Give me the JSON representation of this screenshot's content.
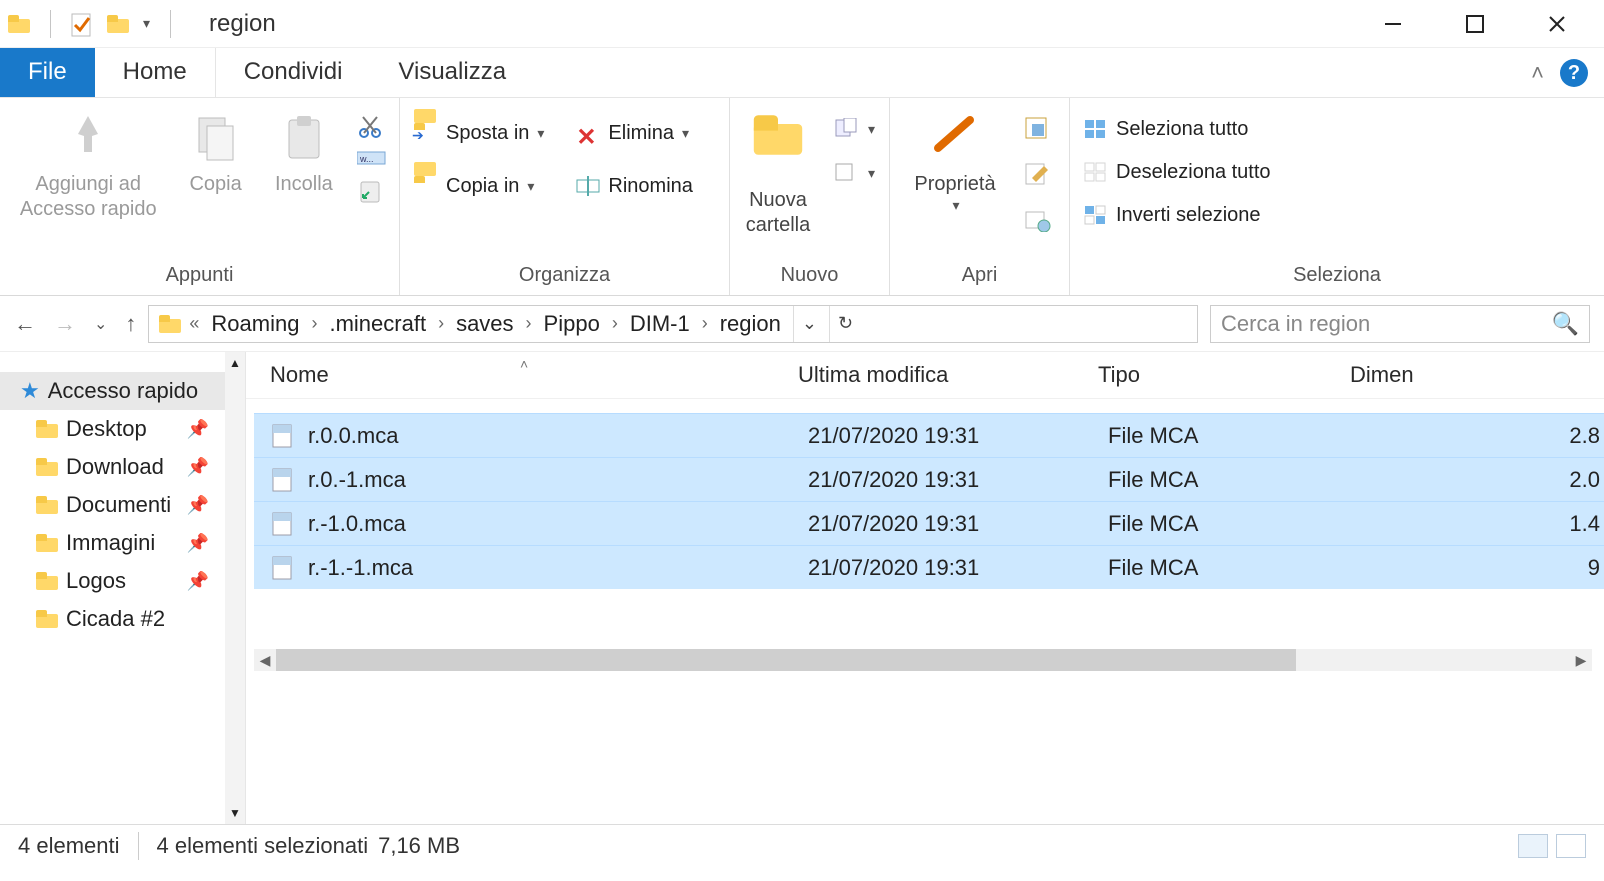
{
  "window": {
    "title": "region"
  },
  "tabs": {
    "file": "File",
    "home": "Home",
    "share": "Condividi",
    "view": "Visualizza"
  },
  "ribbon": {
    "clipboard": {
      "pin": "Aggiungi ad\nAccesso rapido",
      "copy": "Copia",
      "paste": "Incolla",
      "group": "Appunti"
    },
    "organize": {
      "move": "Sposta in",
      "copyto": "Copia in",
      "delete": "Elimina",
      "rename": "Rinomina",
      "group": "Organizza"
    },
    "new": {
      "folder": "Nuova\ncartella",
      "group": "Nuovo"
    },
    "open": {
      "props": "Proprietà",
      "group": "Apri"
    },
    "select": {
      "all": "Seleziona tutto",
      "none": "Deseleziona tutto",
      "invert": "Inverti selezione",
      "group": "Seleziona"
    }
  },
  "breadcrumb": [
    "Roaming",
    ".minecraft",
    "saves",
    "Pippo",
    "DIM-1",
    "region"
  ],
  "search": {
    "placeholder": "Cerca in region"
  },
  "sidebar": {
    "head": "Accesso rapido",
    "items": [
      "Desktop",
      "Download",
      "Documenti",
      "Immagini",
      "Logos",
      "Cicada #2"
    ]
  },
  "columns": {
    "name": "Nome",
    "date": "Ultima modifica",
    "type": "Tipo",
    "size": "Dimen"
  },
  "rows": [
    {
      "name": "r.0.0.mca",
      "date": "21/07/2020 19:31",
      "type": "File MCA",
      "size": "2.8"
    },
    {
      "name": "r.0.-1.mca",
      "date": "21/07/2020 19:31",
      "type": "File MCA",
      "size": "2.0"
    },
    {
      "name": "r.-1.0.mca",
      "date": "21/07/2020 19:31",
      "type": "File MCA",
      "size": "1.4"
    },
    {
      "name": "r.-1.-1.mca",
      "date": "21/07/2020 19:31",
      "type": "File MCA",
      "size": "9"
    }
  ],
  "status": {
    "count": "4 elementi",
    "selected": "4 elementi selezionati",
    "size": "7,16 MB"
  }
}
